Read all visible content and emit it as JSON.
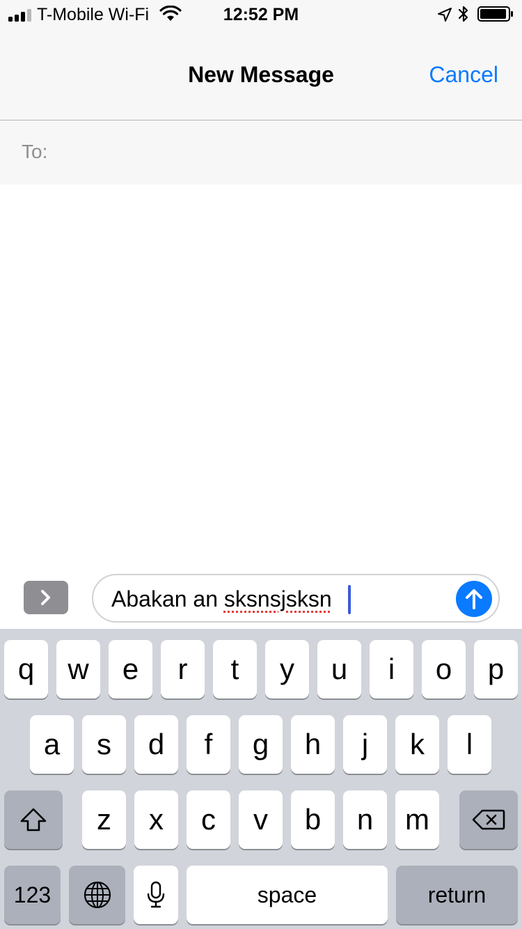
{
  "status_bar": {
    "carrier": "T-Mobile Wi-Fi",
    "time": "12:52 PM",
    "icons": [
      "signal-icon",
      "wifi-icon",
      "location-arrow-icon",
      "bluetooth-icon",
      "battery-icon"
    ]
  },
  "nav": {
    "title": "New Message",
    "cancel_label": "Cancel"
  },
  "recipient": {
    "label": "To:",
    "value": ""
  },
  "compose": {
    "text_plain": "Abakan an ",
    "text_misspelled": "sksnsjsksn",
    "expand_icon": "chevron-right-icon",
    "send_icon": "arrow-up-icon"
  },
  "keyboard": {
    "row1": [
      "q",
      "w",
      "e",
      "r",
      "t",
      "y",
      "u",
      "i",
      "o",
      "p"
    ],
    "row2": [
      "a",
      "s",
      "d",
      "f",
      "g",
      "h",
      "j",
      "k",
      "l"
    ],
    "row3": [
      "z",
      "x",
      "c",
      "v",
      "b",
      "n",
      "m"
    ],
    "numbers_label": "123",
    "space_label": "space",
    "return_label": "return",
    "shift_icon": "shift-icon",
    "delete_icon": "backspace-icon",
    "globe_icon": "globe-icon",
    "mic_icon": "microphone-icon"
  },
  "colors": {
    "accent": "#0a7aff",
    "keyboard_bg": "#d1d4da",
    "key_dark": "#abb0bb",
    "spell_error": "#e53935"
  }
}
